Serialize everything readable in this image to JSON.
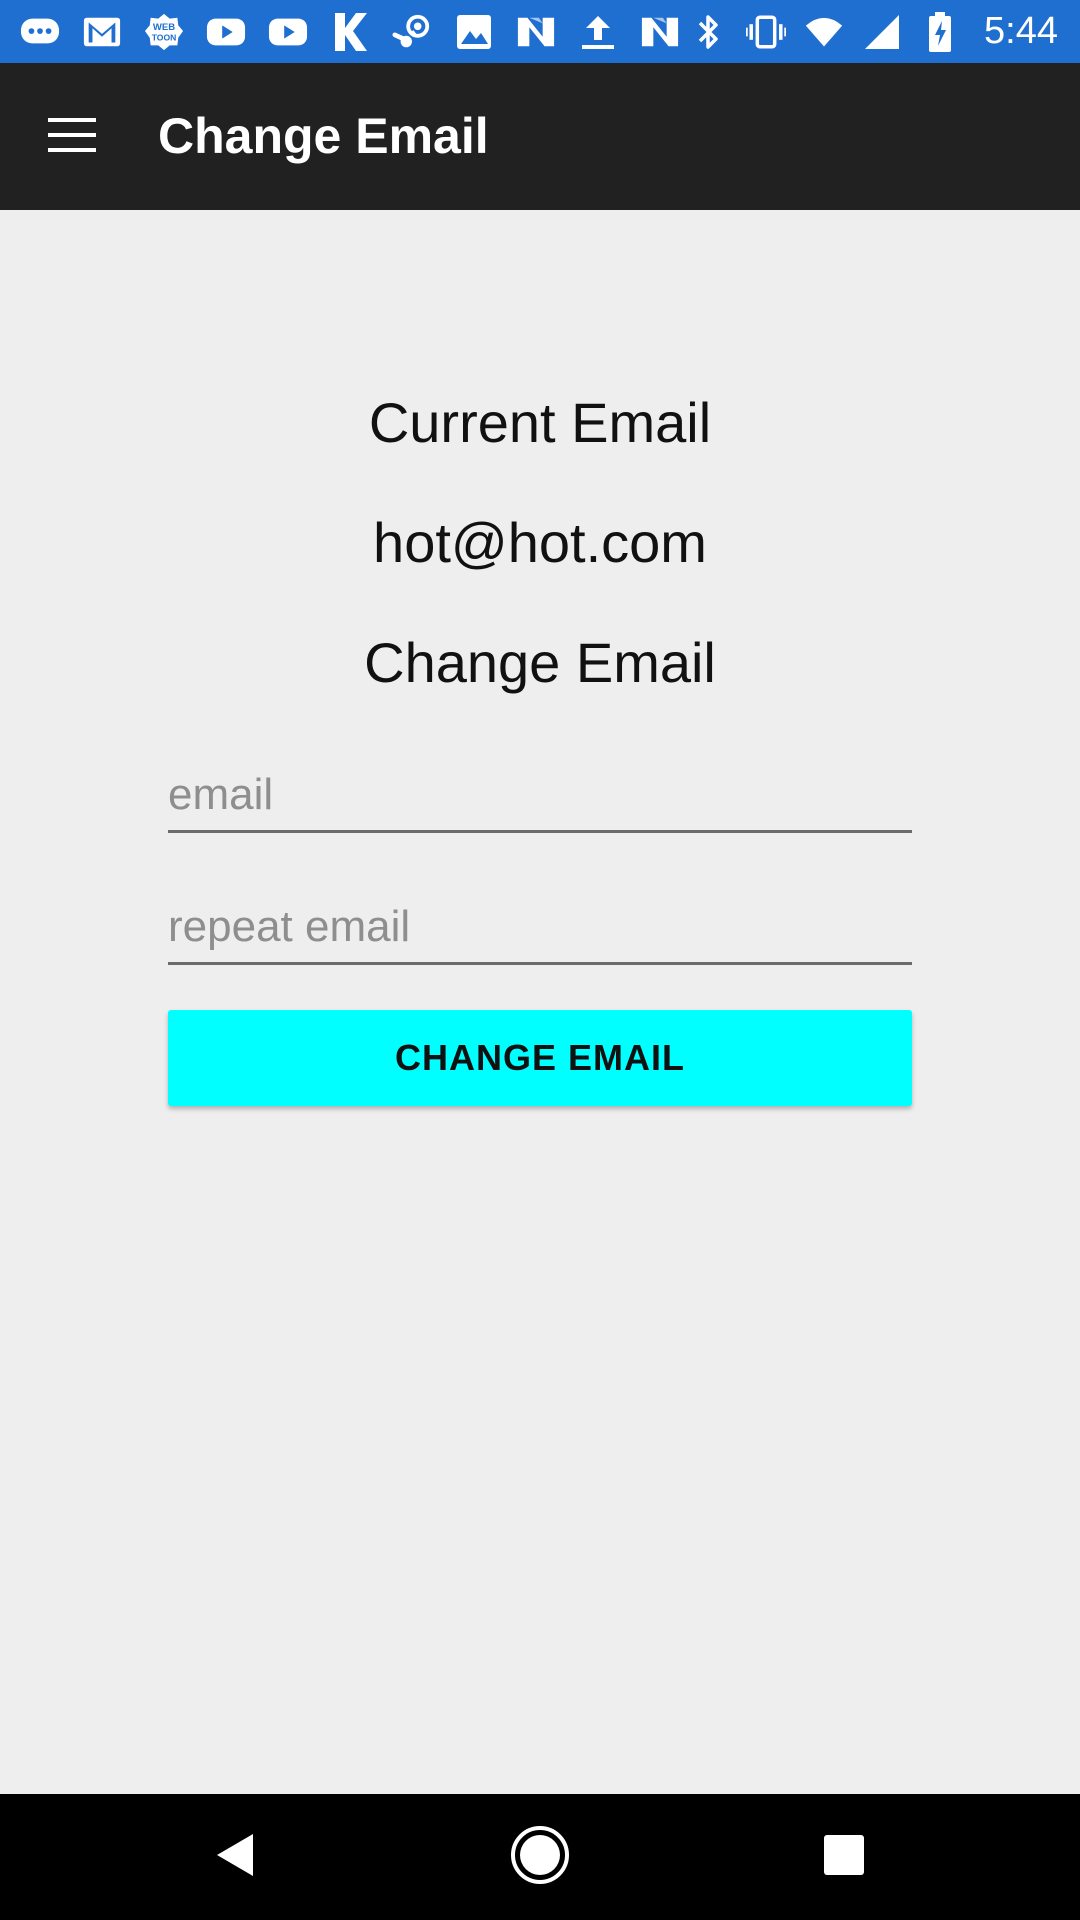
{
  "status_bar": {
    "time": "5:44",
    "left_icons": [
      "messages-icon",
      "gmail-icon",
      "webtoon-icon",
      "youtube-icon",
      "youtube-icon",
      "k-app-icon",
      "steam-icon",
      "image-icon",
      "n-app-icon",
      "upload-icon",
      "n-app-icon"
    ],
    "right_icons": [
      "bluetooth-icon",
      "vibrate-icon",
      "wifi-icon",
      "signal-icon",
      "battery-charging-icon"
    ],
    "color": "#1e6fd0"
  },
  "app_bar": {
    "title": "Change Email",
    "menu_icon": "hamburger-menu-icon",
    "color": "#212121"
  },
  "content": {
    "current_email_label": "Current Email",
    "current_email_value": "hot@hot.com",
    "change_email_label": "Change Email",
    "email_input": {
      "placeholder": "email",
      "value": ""
    },
    "repeat_email_input": {
      "placeholder": "repeat email",
      "value": ""
    },
    "submit_button": {
      "label": "CHANGE EMAIL",
      "color": "#00ffff"
    }
  },
  "nav_bar": {
    "buttons": [
      "back-icon",
      "home-icon",
      "recents-icon"
    ]
  }
}
